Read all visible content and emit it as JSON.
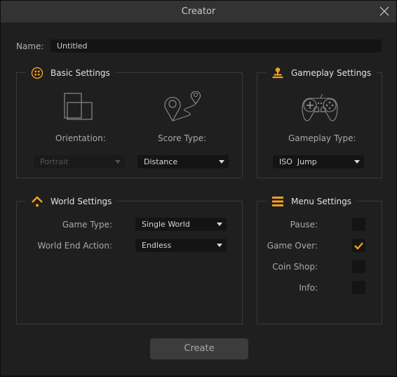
{
  "window": {
    "title": "Creator"
  },
  "name_field": {
    "label": "Name:",
    "value": "Untitled"
  },
  "basic_settings": {
    "title": "Basic Settings",
    "orientation": {
      "label": "Orientation:",
      "value": "Portrait",
      "disabled": true
    },
    "score_type": {
      "label": "Score Type:",
      "value": "Distance"
    }
  },
  "gameplay_settings": {
    "title": "Gameplay Settings",
    "gameplay_type": {
      "label": "Gameplay Type:",
      "value": "ISO  Jump"
    }
  },
  "world_settings": {
    "title": "World Settings",
    "game_type": {
      "label": "Game Type:",
      "value": "Single World"
    },
    "world_end_action": {
      "label": "World End Action:",
      "value": "Endless"
    }
  },
  "menu_settings": {
    "title": "Menu Settings",
    "items": [
      {
        "label": "Pause:",
        "checked": false
      },
      {
        "label": "Game Over:",
        "checked": true
      },
      {
        "label": "Coin Shop:",
        "checked": false
      },
      {
        "label": "Info:",
        "checked": false
      }
    ]
  },
  "create_button": {
    "label": "Create"
  },
  "colors": {
    "accent": "#f0a020",
    "background": "#1f1f1f",
    "titlebar": "#333333",
    "field": "#141414"
  }
}
